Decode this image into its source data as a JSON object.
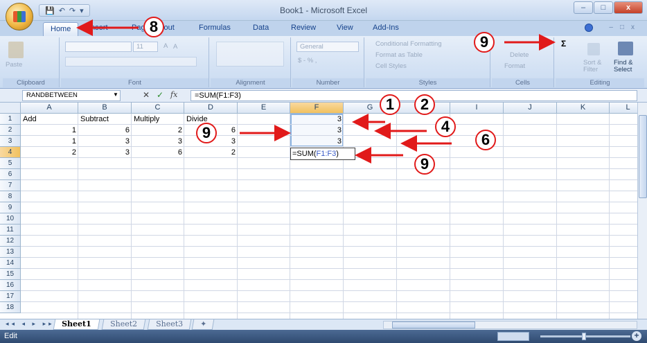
{
  "window": {
    "title": "Book1 - Microsoft Excel",
    "controls": [
      "–",
      "□",
      "x"
    ]
  },
  "quick_access": [
    "💾",
    "↶",
    "↷",
    "▾"
  ],
  "ribbon_tabs": [
    {
      "label": "Home",
      "active": true
    },
    {
      "label": "Insert",
      "active": false
    },
    {
      "label": "Page Layout",
      "active": false
    },
    {
      "label": "Formulas",
      "active": false
    },
    {
      "label": "Data",
      "active": false
    },
    {
      "label": "Review",
      "active": false
    },
    {
      "label": "View",
      "active": false
    },
    {
      "label": "Add-Ins",
      "active": false
    }
  ],
  "ribbon": {
    "clipboard": {
      "label": "Clipboard",
      "paste": "Paste"
    },
    "font": {
      "label": "Font",
      "size": "11",
      "grow": "A",
      "shrink": "A"
    },
    "alignment": {
      "label": "Alignment"
    },
    "number": {
      "label": "Number",
      "format": "General",
      "currency": "$ - % ,"
    },
    "styles": {
      "label": "Styles",
      "conditional": "Conditional Formatting",
      "format_table": "Format as Table",
      "cell_styles": "Cell Styles"
    },
    "cells": {
      "label": "Cells",
      "delete": "Delete",
      "format": "Format"
    },
    "editing": {
      "label": "Editing",
      "sigma": "Σ",
      "sort": "Sort & Filter",
      "find": "Find & Select"
    }
  },
  "formula_bar": {
    "name_box": "RANDBETWEEN",
    "cancel": "✕",
    "enter": "✓",
    "fx": "fx",
    "formula": "=SUM(F1:F3)"
  },
  "columns": [
    "A",
    "B",
    "C",
    "D",
    "E",
    "F",
    "G",
    "H",
    "I",
    "J",
    "K",
    "L"
  ],
  "selected_column": "F",
  "selected_row": "4",
  "rows": [
    "1",
    "2",
    "3",
    "4",
    "5",
    "6",
    "7",
    "8",
    "9",
    "10",
    "11",
    "12",
    "13",
    "14",
    "15",
    "16",
    "17",
    "18"
  ],
  "cells": {
    "A1": "Add",
    "B1": "Subtract",
    "C1": "Multiply",
    "D1": "Divide",
    "A2": "1",
    "B2": "6",
    "C2": "2",
    "D2": "6",
    "A3": "1",
    "B3": "3",
    "C3": "3",
    "D3": "3",
    "A4": "2",
    "B4": "3",
    "C4": "6",
    "D4": "2",
    "F1": "3",
    "F2": "3",
    "F3": "3"
  },
  "edit_cell": {
    "prefix": "=SUM(",
    "ref": "F1:F3",
    "suffix": ")"
  },
  "sheets": [
    {
      "label": "Sheet1",
      "active": true
    },
    {
      "label": "Sheet2",
      "active": false
    },
    {
      "label": "Sheet3",
      "active": false
    }
  ],
  "sheet_nav": "◂◂ ◂ ▸ ▸▸",
  "status": {
    "mode": "Edit",
    "zoom_plus": "+"
  },
  "annotations": {
    "c8": "8",
    "c9_top": "9",
    "c1": "1",
    "c2": "2",
    "c9_left": "9",
    "c4": "4",
    "c6": "6",
    "c9_bottom": "9"
  },
  "colors": {
    "annotation": "#e11a1a",
    "selected_header": "#f1c15f",
    "ribbon": "#d4e2f4"
  }
}
